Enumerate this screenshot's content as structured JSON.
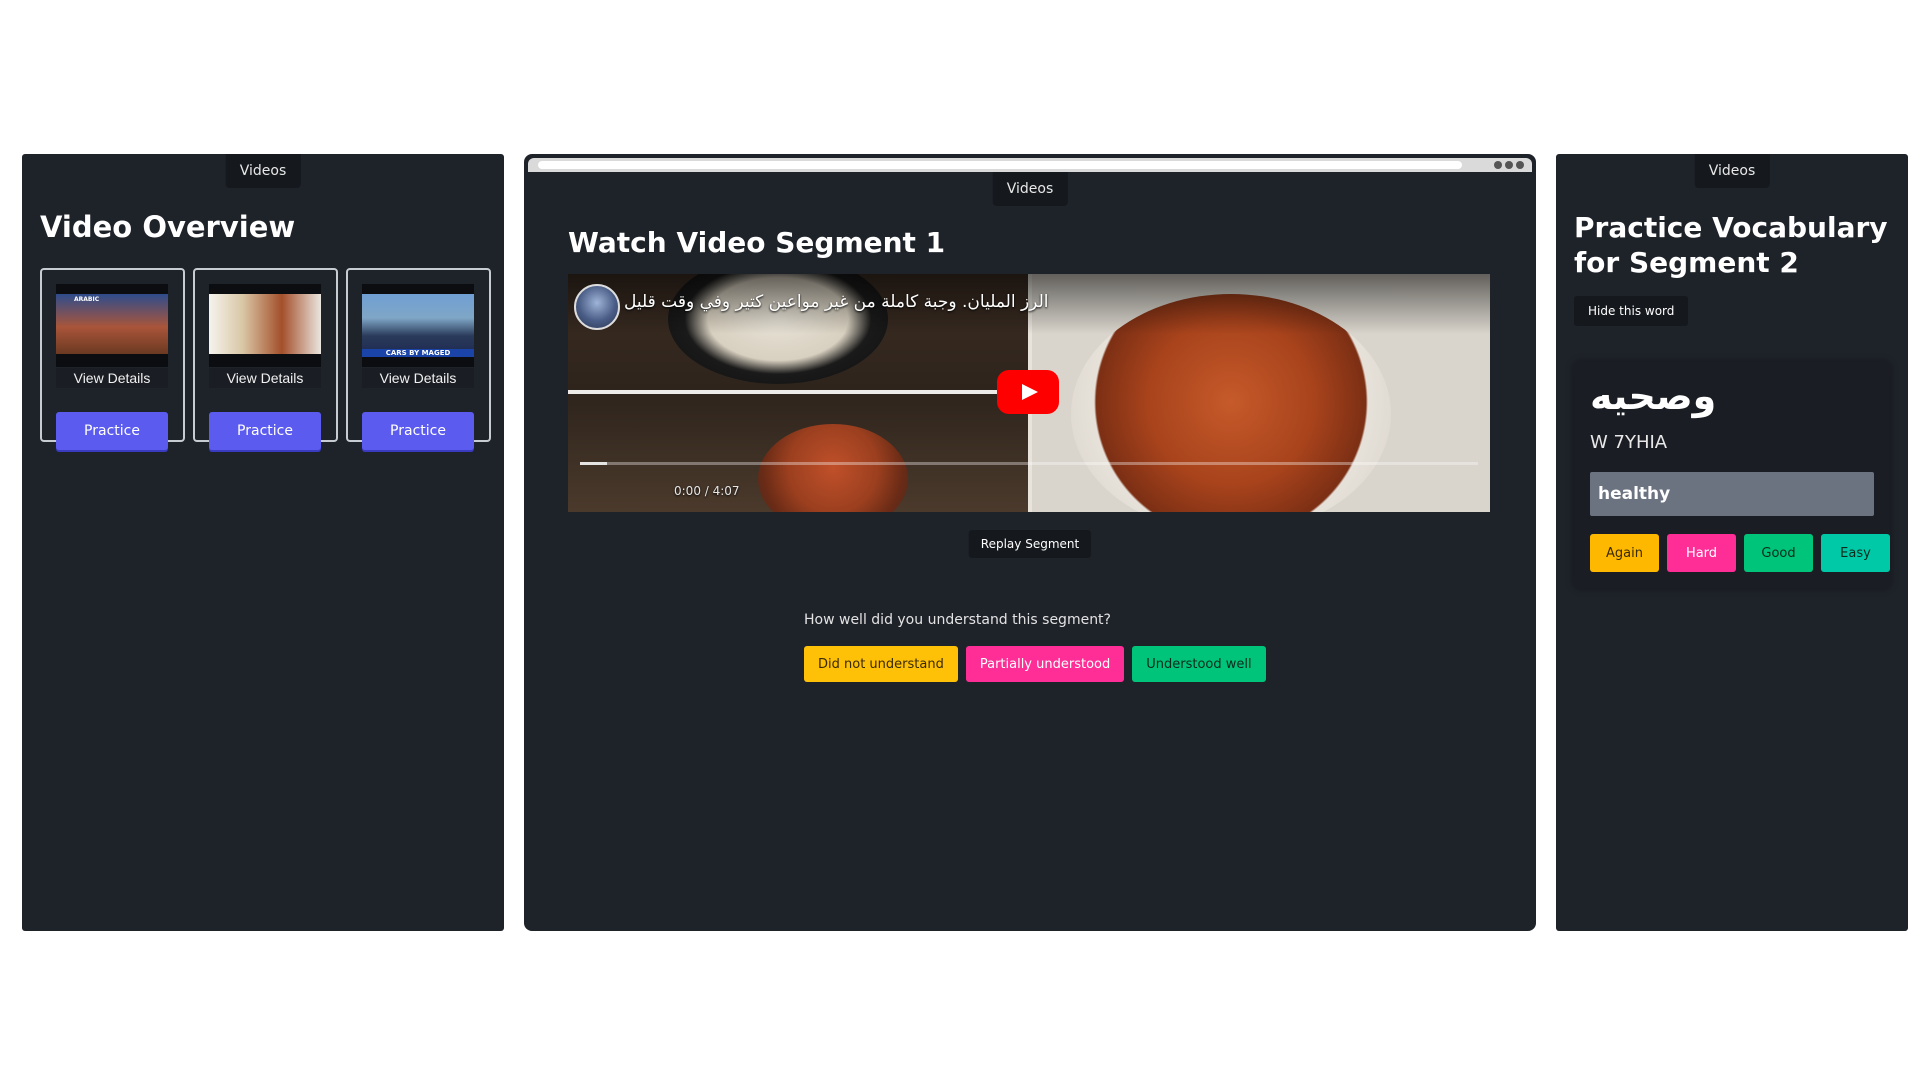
{
  "left_panel": {
    "tab": "Videos",
    "title": "Video Overview",
    "cards": [
      {
        "thumb_caption": "ARABIC",
        "details": "View Details",
        "practice": "Practice"
      },
      {
        "thumb_caption": "",
        "details": "View Details",
        "practice": "Practice"
      },
      {
        "thumb_caption": "CARS BY MAGED",
        "details": "View Details",
        "practice": "Practice"
      }
    ]
  },
  "middle_panel": {
    "tab": "Videos",
    "title": "Watch Video Segment 1",
    "video": {
      "title": "الرز المليان. وجبة كاملة من غير مواعين كتير وفي وقت قليل",
      "time": "0:00 / 4:07",
      "progress_fraction": 0.0
    },
    "replay": "Replay Segment",
    "question": "How well did you understand this segment?",
    "ratings": [
      "Did not understand",
      "Partially understood",
      "Understood well"
    ],
    "rating_colors": [
      "#ffc107",
      "#ff2d96",
      "#00c47a"
    ]
  },
  "right_panel": {
    "tab": "Videos",
    "title": "Practice Vocabulary for Segment 2",
    "hide_word": "Hide this word",
    "word": "وصحيه",
    "transliteration": "W 7YHIA",
    "answer_value": "healthy",
    "buttons": [
      "Again",
      "Hard",
      "Good",
      "Easy"
    ],
    "button_colors": [
      "#ffb800",
      "#ff2d96",
      "#00c47a",
      "#00c9a7"
    ]
  },
  "icons": {
    "play": "play-icon",
    "channel_avatar": "avatar"
  }
}
